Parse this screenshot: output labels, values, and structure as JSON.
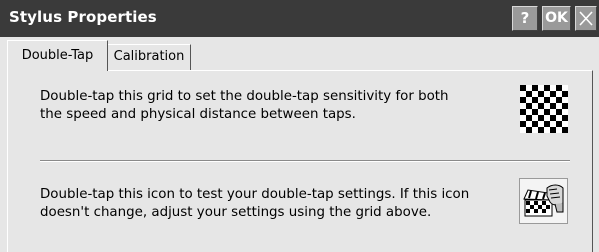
{
  "window": {
    "title": "Stylus Properties",
    "help_button": "?",
    "ok_button": "OK"
  },
  "tabs": [
    {
      "label": "Double-Tap",
      "active": true
    },
    {
      "label": "Calibration",
      "active": false
    }
  ],
  "double_tap": {
    "grid_instruction": "Double-tap this grid to set the double-tap sensitivity for both\nthe speed and physical distance between taps.",
    "test_instruction": "Double-tap this icon to test your double-tap settings. If this icon\ndoesn't change, adjust your settings using the grid above."
  },
  "colors": {
    "titlebar": "#3a3a3a",
    "background": "#e6e6e6",
    "title_button": "#9a9a9a"
  },
  "icons": {
    "grid": "checkerboard-grid-icon",
    "test": "hand-clapperboard-icon",
    "close": "close-icon"
  }
}
